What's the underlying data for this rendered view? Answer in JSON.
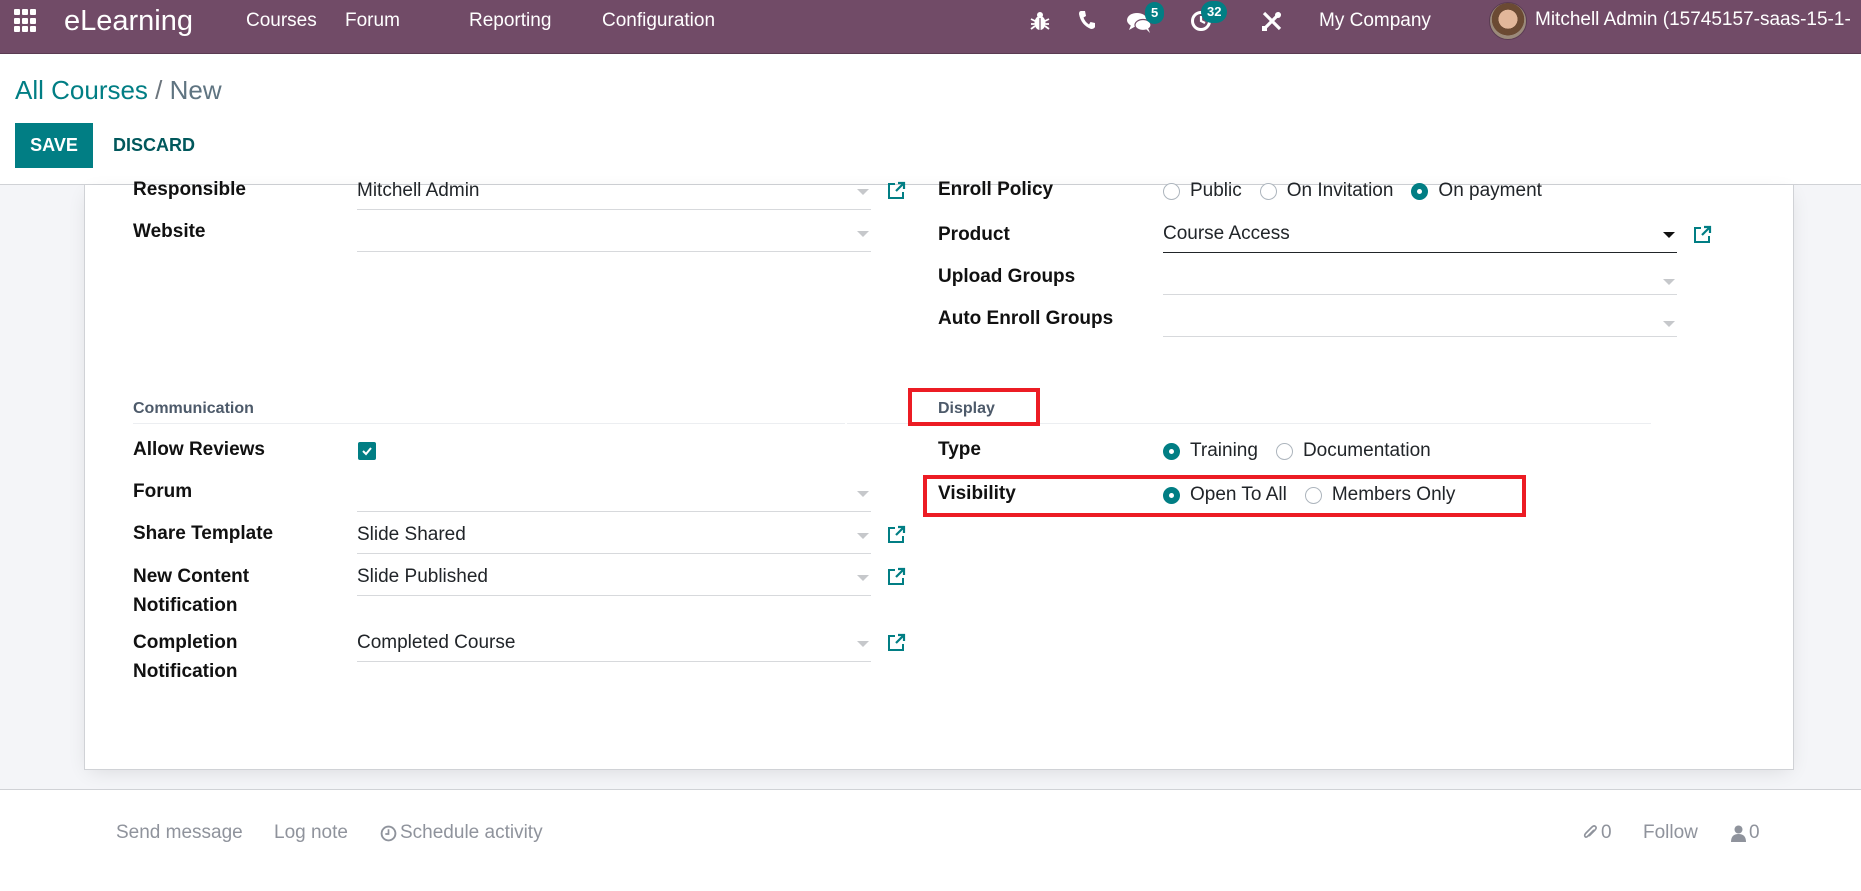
{
  "navbar": {
    "app_name": "eLearning",
    "menu": [
      "Courses",
      "Forum",
      "Reporting",
      "Configuration"
    ],
    "messages_badge": "5",
    "activities_badge": "32",
    "company": "My Company",
    "user": "Mitchell Admin (15745157-saas-15-1-",
    "colors": {
      "bar": "#714B67",
      "badge": "#017e84"
    }
  },
  "control_panel": {
    "breadcrumb_parent": "All Courses",
    "breadcrumb_sep": " / ",
    "breadcrumb_current": "New",
    "save_label": "SAVE",
    "discard_label": "DISCARD"
  },
  "form": {
    "left": {
      "responsible": {
        "label": "Responsible",
        "value": "Mitchell Admin"
      },
      "website": {
        "label": "Website",
        "value": ""
      },
      "communication_title": "Communication",
      "allow_reviews": {
        "label": "Allow Reviews",
        "checked": true
      },
      "forum": {
        "label": "Forum",
        "value": ""
      },
      "share_template": {
        "label": "Share Template",
        "value": "Slide Shared"
      },
      "new_content_notification": {
        "label": "New Content Notification",
        "value": "Slide Published"
      },
      "completion_notification": {
        "label": "Completion Notification",
        "value": "Completed Course"
      }
    },
    "right": {
      "enroll_policy": {
        "label": "Enroll Policy",
        "options": [
          "Public",
          "On Invitation",
          "On payment"
        ],
        "selected": "On payment"
      },
      "product": {
        "label": "Product",
        "value": "Course Access"
      },
      "upload_groups": {
        "label": "Upload Groups",
        "value": ""
      },
      "auto_enroll_groups": {
        "label": "Auto Enroll Groups",
        "value": ""
      },
      "display_title": "Display",
      "type": {
        "label": "Type",
        "options": [
          "Training",
          "Documentation"
        ],
        "selected": "Training"
      },
      "visibility": {
        "label": "Visibility",
        "options": [
          "Open To All",
          "Members Only"
        ],
        "selected": "Open To All"
      }
    }
  },
  "chatter": {
    "send_message": "Send message",
    "log_note": "Log note",
    "schedule_activity": "Schedule activity",
    "attachments_count": "0",
    "follow": "Follow",
    "followers_count": "0"
  },
  "annotations": {
    "highlight_color": "#ec1c24"
  }
}
